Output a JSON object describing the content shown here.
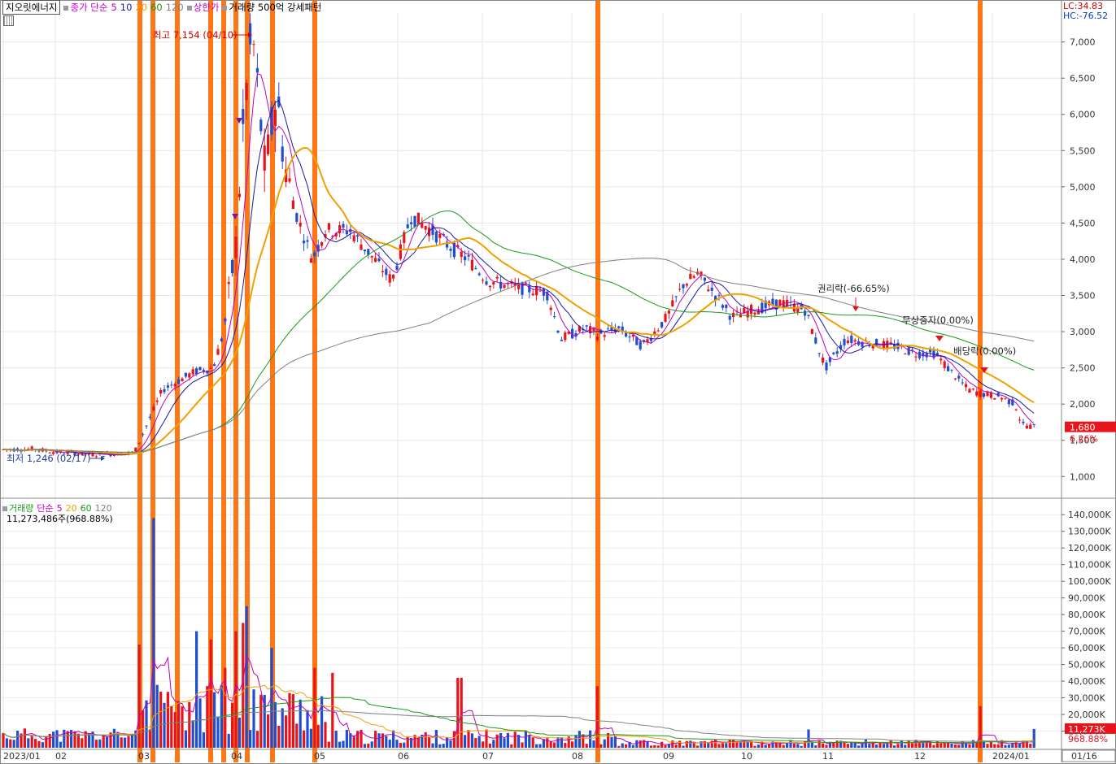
{
  "header": {
    "stock_name": "지오릿에너지",
    "price_legend": "종가 단순",
    "ma_periods": [
      "5",
      "10",
      "20",
      "60",
      "120"
    ],
    "ma_colors": [
      "#c000c0",
      "#1a1aa0",
      "#f0a000",
      "#1a9a1a",
      "#808080"
    ],
    "limit_up": "상한가",
    "volume_pattern": "거래량 500억 강세패턴",
    "lc": "LC:34.83",
    "hc": "HC:-76.52"
  },
  "volume_header": {
    "label": "거래량",
    "ma_label": "단순",
    "ma_periods": [
      "5",
      "20",
      "60",
      "120"
    ],
    "info": "11,273,486주(968.88%)"
  },
  "price_axis": {
    "ticks": [
      "7,000",
      "6,500",
      "6,000",
      "5,500",
      "5,000",
      "4,500",
      "4,000",
      "3,500",
      "3,000",
      "2,500",
      "2,000",
      "1,500",
      "1,000"
    ],
    "tick_values": [
      7000,
      6500,
      6000,
      5500,
      5000,
      4500,
      4000,
      3500,
      3000,
      2500,
      2000,
      1500,
      1000
    ],
    "current_price": "1,680",
    "current_change": "6.26%"
  },
  "volume_axis": {
    "ticks": [
      "140,000K",
      "130,000K",
      "120,000K",
      "110,000K",
      "100,000K",
      "90,000K",
      "80,000K",
      "70,000K",
      "60,000K",
      "50,000K",
      "40,000K",
      "30,000K",
      "20,000K",
      "10,000K"
    ],
    "tick_values": [
      140000,
      130000,
      120000,
      110000,
      100000,
      90000,
      80000,
      70000,
      60000,
      50000,
      40000,
      30000,
      20000,
      10000
    ],
    "current_volume": "11,273K",
    "current_ratio": "968.88%"
  },
  "x_axis": {
    "labels": [
      "2023/01",
      "02",
      "03",
      "04",
      "05",
      "06",
      "07",
      "08",
      "09",
      "10",
      "11",
      "12",
      "2024/01"
    ],
    "date_box": "01/16"
  },
  "annotations": {
    "high": "최고 7,154 (04/10)",
    "low": "최저 1,246 (02/17)",
    "rights": "권리락(-66.65%)",
    "bonus": "무상증자(0.00%)",
    "dividend": "배당락(0.00%)"
  },
  "chart_data": {
    "type": "candlestick",
    "title": "지오릿에너지",
    "period": "daily 2023/01 – 2024/01/16",
    "price_ylim": [
      700,
      7400
    ],
    "volume_ylim": [
      0,
      145000
    ],
    "high": {
      "value": 7154,
      "date": "04/10"
    },
    "low": {
      "value": 1246,
      "date": "02/17"
    },
    "last": {
      "close": 1680,
      "change_pct": 6.26,
      "volume": 11273486,
      "volume_ratio_pct": 968.88
    },
    "price_monthly_path": [
      {
        "month": "2023/01",
        "close": 1370
      },
      {
        "month": "02",
        "close": 1330
      },
      {
        "month": "03",
        "close": 2300
      },
      {
        "month": "04",
        "close": 5900
      },
      {
        "month": "05",
        "close": 4300
      },
      {
        "month": "06",
        "close": 4500
      },
      {
        "month": "07",
        "close": 3500
      },
      {
        "month": "08",
        "close": 2900
      },
      {
        "month": "09",
        "close": 3750
      },
      {
        "month": "10",
        "close": 3350
      },
      {
        "month": "11",
        "close": 2850
      },
      {
        "month": "12",
        "close": 2500
      },
      {
        "month": "2024/01",
        "close": 1680
      }
    ],
    "moving_averages": [
      {
        "name": "5",
        "color": "#c000c0"
      },
      {
        "name": "10",
        "color": "#1a1aa0"
      },
      {
        "name": "20",
        "color": "#f0a000"
      },
      {
        "name": "60",
        "color": "#1a9a1a"
      },
      {
        "name": "120",
        "color": "#808080"
      }
    ],
    "peak_volumes_k": [
      {
        "month": "03",
        "value": 138000
      },
      {
        "month": "04",
        "value": 85000
      },
      {
        "month": "08",
        "value": 37000
      },
      {
        "month": "2024/01",
        "value": 11273
      }
    ],
    "signal_months": [
      "03",
      "03",
      "03",
      "03",
      "04",
      "04",
      "04",
      "04",
      "05",
      "05",
      "08",
      "12"
    ]
  }
}
